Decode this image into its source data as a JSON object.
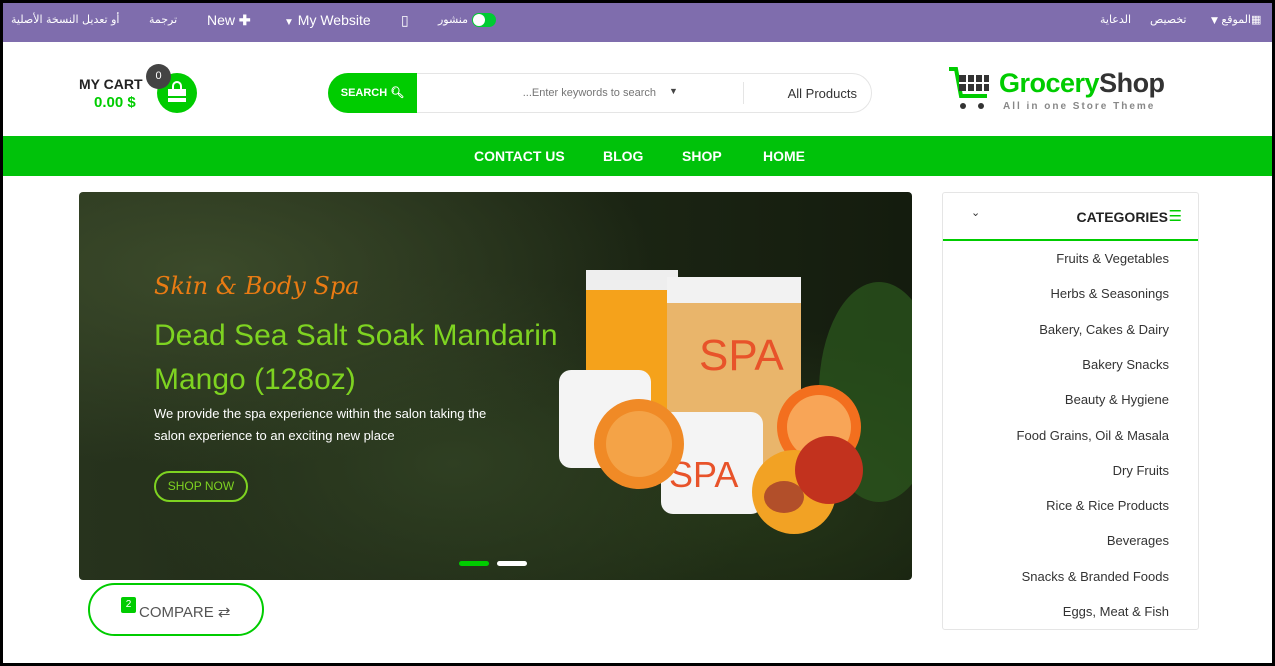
{
  "topbar": {
    "edit_original": "أو تعديل النسخة الأصلية",
    "translate": "ترجمة",
    "new": "New",
    "website": "My Website",
    "published": "منشور",
    "site": "الموقع",
    "customize": "تخصيص",
    "promote": "الدعاية"
  },
  "header": {
    "cart_label": "MY CART",
    "cart_total": "0.00 $",
    "cart_count": "0",
    "search_button": "SEARCH",
    "search_placeholder": "...Enter keywords to search",
    "category_select": "All Products",
    "logo_brand_green": "Grocery",
    "logo_brand_dark": "Shop",
    "logo_tagline": "All in one Store Theme"
  },
  "nav": [
    "CONTACT US",
    "BLOG",
    "SHOP",
    "HOME"
  ],
  "banner": {
    "subtitle": "Skin & Body Spa",
    "title": "Dead Sea Salt Soak Mandarin Mango (128oz)",
    "description": "We provide the spa experience within the salon taking the salon experience to an exciting new place",
    "button": "SHOP NOW",
    "slides": 2,
    "active_slide": 1
  },
  "compare": {
    "count": "2",
    "label": "COMPARE"
  },
  "categories": {
    "title": "CATEGORIES",
    "items": [
      "Fruits & Vegetables",
      "Herbs & Seasonings",
      "Bakery, Cakes & Dairy",
      "Bakery Snacks",
      "Beauty & Hygiene",
      "Food Grains, Oil & Masala",
      "Dry Fruits",
      "Rice & Rice Products",
      "Beverages",
      "Snacks & Branded Foods",
      "Eggs, Meat & Fish"
    ]
  },
  "colors": {
    "topbar": "#7f6dad",
    "accent": "#00c20a",
    "banner_title": "#7ed321",
    "banner_subtitle": "#e97b13"
  }
}
